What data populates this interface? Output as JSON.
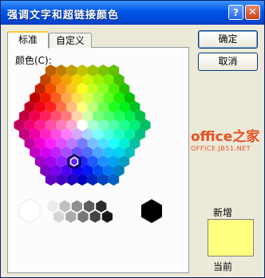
{
  "dialog": {
    "title": "强调文字和超链接颜色",
    "help_glyph": "?",
    "close_glyph": "✕"
  },
  "tabs": [
    {
      "label": "标准",
      "active": true
    },
    {
      "label": "自定义",
      "active": false
    }
  ],
  "colors_label": "颜色(C):",
  "buttons": {
    "ok": "确定",
    "cancel": "取消"
  },
  "watermark": {
    "main": "office之家",
    "sub": "OFFICE.JB51.NET"
  },
  "preview": {
    "new_label": "新增",
    "current_label": "当前",
    "new_color": "#ffff80"
  },
  "palette": {
    "selected_color": "#ff9900",
    "grays": [
      "#ffffff",
      "#ececec",
      "#d6d6d6",
      "#c0c0c0",
      "#aaaaaa",
      "#8f8f8f",
      "#777777",
      "#5c5c5c",
      "#444444",
      "#2c2c2c",
      "#161616",
      "#000000"
    ]
  }
}
